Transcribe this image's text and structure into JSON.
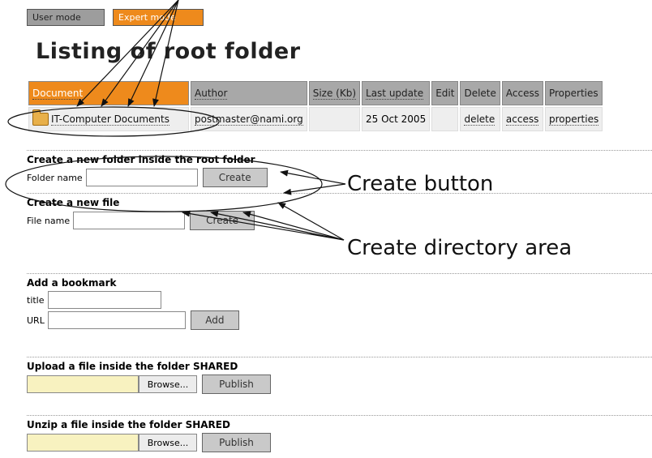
{
  "modes": {
    "user": "User mode",
    "expert": "Expert mode"
  },
  "page_title": "Listing of root folder",
  "table": {
    "headers": [
      "Document",
      "Author",
      "Size (Kb)",
      "Last update",
      "Edit",
      "Delete",
      "Access",
      "Properties"
    ],
    "row": {
      "document": "IT-Computer Documents",
      "author": "postmaster@nami.org",
      "size": "",
      "last_update": "25 Oct 2005",
      "edit": "",
      "delete": "delete",
      "access": "access",
      "properties": "properties"
    }
  },
  "new_folder": {
    "title": "Create a new folder inside the root folder",
    "label": "Folder name",
    "button": "Create"
  },
  "new_file": {
    "title": "Create a new file",
    "label": "File name",
    "button": "Create"
  },
  "bookmark": {
    "title": "Add a bookmark",
    "title_label": "title",
    "url_label": "URL",
    "button": "Add"
  },
  "upload": {
    "title": "Upload a file inside the folder SHARED",
    "browse": "Browse...",
    "button": "Publish"
  },
  "unzip": {
    "title": "Unzip a file inside the folder SHARED",
    "browse": "Browse...",
    "button": "Publish"
  },
  "annotations": {
    "create_button": "Create button",
    "create_area": "Create directory area"
  }
}
